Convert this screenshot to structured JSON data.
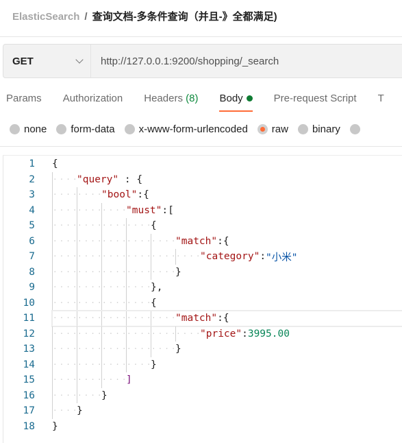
{
  "breadcrumb": {
    "root": "ElasticSearch",
    "separator": "/",
    "current": "查询文档-多条件查询（并且-》全都满足)"
  },
  "request": {
    "method": "GET",
    "url": "http://127.0.0.1:9200/shopping/_search"
  },
  "tabs": [
    {
      "label": "Params"
    },
    {
      "label": "Authorization"
    },
    {
      "label": "Headers",
      "count": "(8)"
    },
    {
      "label": "Body",
      "active": true
    },
    {
      "label": "Pre-request Script"
    },
    {
      "label": "T"
    }
  ],
  "body_modes": [
    {
      "label": "none"
    },
    {
      "label": "form-data"
    },
    {
      "label": "x-www-form-urlencoded"
    },
    {
      "label": "raw",
      "selected": true
    },
    {
      "label": "binary"
    },
    {
      "label": ""
    }
  ],
  "colors": {
    "accent": "#ff6c37",
    "body_dot": "#0f7c33",
    "key": "#a31515",
    "string": "#0451a5",
    "number": "#098658"
  },
  "editor": {
    "highlighted_line": 11,
    "lines": [
      {
        "n": "1",
        "indent": 0,
        "tokens": [
          [
            "b",
            "{"
          ]
        ]
      },
      {
        "n": "2",
        "indent": 1,
        "tokens": [
          [
            "k",
            "\"query\""
          ],
          [
            "p",
            " : "
          ],
          [
            "b",
            "{"
          ]
        ]
      },
      {
        "n": "3",
        "indent": 2,
        "tokens": [
          [
            "k",
            "\"bool\""
          ],
          [
            "p",
            ":"
          ],
          [
            "b",
            "{"
          ]
        ]
      },
      {
        "n": "4",
        "indent": 3,
        "tokens": [
          [
            "k",
            "\"must\""
          ],
          [
            "p",
            ":"
          ],
          [
            "b",
            "["
          ]
        ]
      },
      {
        "n": "5",
        "indent": 4,
        "tokens": [
          [
            "b",
            "{"
          ]
        ]
      },
      {
        "n": "6",
        "indent": 5,
        "tokens": [
          [
            "k",
            "\"match\""
          ],
          [
            "p",
            ":"
          ],
          [
            "b",
            "{"
          ]
        ]
      },
      {
        "n": "7",
        "indent": 6,
        "tokens": [
          [
            "k",
            "\"category\""
          ],
          [
            "p",
            ":"
          ],
          [
            "s",
            "\"小米\""
          ]
        ]
      },
      {
        "n": "8",
        "indent": 5,
        "tokens": [
          [
            "b",
            "}"
          ]
        ]
      },
      {
        "n": "9",
        "indent": 4,
        "tokens": [
          [
            "b",
            "}"
          ],
          [
            "p",
            ","
          ]
        ]
      },
      {
        "n": "10",
        "indent": 4,
        "tokens": [
          [
            "b",
            "{"
          ]
        ]
      },
      {
        "n": "11",
        "indent": 5,
        "tokens": [
          [
            "k",
            "\"match\""
          ],
          [
            "p",
            ":"
          ],
          [
            "b",
            "{"
          ]
        ]
      },
      {
        "n": "12",
        "indent": 6,
        "tokens": [
          [
            "k",
            "\"price\""
          ],
          [
            "p",
            ":"
          ],
          [
            "n",
            "3995.00"
          ]
        ]
      },
      {
        "n": "13",
        "indent": 5,
        "tokens": [
          [
            "b",
            "}"
          ]
        ]
      },
      {
        "n": "14",
        "indent": 4,
        "tokens": [
          [
            "b",
            "}"
          ]
        ]
      },
      {
        "n": "15",
        "indent": 3,
        "tokens": [
          [
            "brk",
            "]"
          ]
        ]
      },
      {
        "n": "16",
        "indent": 2,
        "tokens": [
          [
            "b",
            "}"
          ]
        ]
      },
      {
        "n": "17",
        "indent": 1,
        "tokens": [
          [
            "b",
            "}"
          ]
        ]
      },
      {
        "n": "18",
        "indent": 0,
        "tokens": [
          [
            "b",
            "}"
          ]
        ]
      }
    ]
  }
}
